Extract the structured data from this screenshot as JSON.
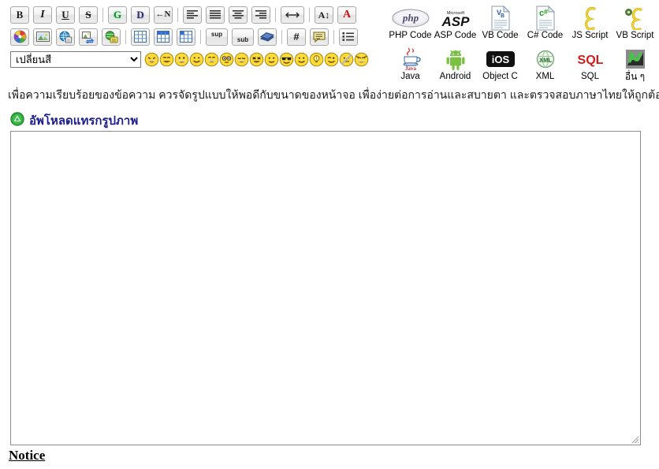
{
  "editor": {
    "toolbar_row1": [
      {
        "name": "bold-button",
        "glyph": "B",
        "cls": "bold-g",
        "title": "Bold"
      },
      {
        "name": "italic-button",
        "glyph": "I",
        "cls": "ital-g",
        "title": "Italic"
      },
      {
        "name": "underline-button",
        "glyph": "U",
        "cls": "und-g",
        "title": "Underline"
      },
      {
        "name": "strikethrough-button",
        "glyph": "S",
        "cls": "strk-g",
        "title": "Strikethrough"
      },
      {
        "name": "separator",
        "glyph": "",
        "cls": "",
        "title": ""
      },
      {
        "name": "glow-text-button",
        "glyph": "G",
        "cls": "glow-g",
        "title": "Glow"
      },
      {
        "name": "shadow-text-button",
        "glyph": "D",
        "cls": "shad-g",
        "title": "Shadow"
      },
      {
        "name": "right-to-left-button",
        "glyph": "←N",
        "cls": "rtl-g",
        "title": "Right to left"
      },
      {
        "name": "separator",
        "glyph": "",
        "cls": "",
        "title": ""
      },
      {
        "name": "align-left-button",
        "glyph": "",
        "cls": "",
        "title": "Align left"
      },
      {
        "name": "align-justify-button",
        "glyph": "",
        "cls": "",
        "title": "Justify"
      },
      {
        "name": "align-center-button",
        "glyph": "",
        "cls": "",
        "title": "Align center"
      },
      {
        "name": "align-right-button",
        "glyph": "",
        "cls": "",
        "title": "Align right"
      },
      {
        "name": "separator",
        "glyph": "",
        "cls": "",
        "title": ""
      },
      {
        "name": "horizontal-rule-button",
        "glyph": "↔",
        "cls": "",
        "title": "Horizontal rule"
      },
      {
        "name": "separator",
        "glyph": "",
        "cls": "",
        "title": ""
      },
      {
        "name": "font-size-button",
        "glyph": "A↕",
        "cls": "fsz-g",
        "title": "Font size"
      },
      {
        "name": "font-color-button",
        "glyph": "A",
        "cls": "fcol-g",
        "title": "Font color"
      }
    ],
    "toolbar_row2": [
      {
        "name": "color-wheel-button",
        "title": "Color wheel"
      },
      {
        "name": "insert-image-button",
        "title": "Insert image"
      },
      {
        "name": "insert-link-button",
        "title": "Insert link"
      },
      {
        "name": "insert-media-button",
        "title": "Insert media"
      },
      {
        "name": "insert-flash-button",
        "title": "Insert flash"
      },
      {
        "name": "separator",
        "title": ""
      },
      {
        "name": "insert-table-button",
        "title": "Insert table"
      },
      {
        "name": "table-header-button",
        "title": "Table header"
      },
      {
        "name": "table-cell-button",
        "title": "Table cell"
      },
      {
        "name": "separator",
        "title": ""
      },
      {
        "name": "superscript-button",
        "title": "Superscript"
      },
      {
        "name": "subscript-button",
        "title": "Subscript"
      },
      {
        "name": "insert-book-button",
        "title": "Insert book"
      },
      {
        "name": "separator",
        "title": ""
      },
      {
        "name": "numbered-list-button",
        "title": "Numbered list"
      },
      {
        "name": "quote-button",
        "title": "Quote"
      },
      {
        "name": "separator",
        "title": ""
      },
      {
        "name": "bullet-list-button",
        "title": "Bullet list"
      }
    ],
    "color_select": {
      "selected": "เปลี่ยนสี",
      "options": [
        "เปลี่ยนสี"
      ]
    },
    "emoticons": [
      {
        "name": "emoticon-laugh",
        "label": "laugh"
      },
      {
        "name": "emoticon-grin",
        "label": "grin"
      },
      {
        "name": "emoticon-bigsmile",
        "label": "big-smile"
      },
      {
        "name": "emoticon-smile",
        "label": "smile"
      },
      {
        "name": "emoticon-happy",
        "label": "happy"
      },
      {
        "name": "emoticon-surprised",
        "label": "surprised"
      },
      {
        "name": "emoticon-sleepy",
        "label": "sleepy"
      },
      {
        "name": "emoticon-cool",
        "label": "cool"
      },
      {
        "name": "emoticon-neutral",
        "label": "neutral"
      },
      {
        "name": "emoticon-sunglasses",
        "label": "sunglasses"
      },
      {
        "name": "emoticon-plain",
        "label": "plain"
      },
      {
        "name": "emoticon-idea",
        "label": "idea"
      },
      {
        "name": "emoticon-wink",
        "label": "wink"
      },
      {
        "name": "emoticon-nocomment",
        "label": "no-comment"
      },
      {
        "name": "emoticon-devil",
        "label": "devil"
      }
    ],
    "hint_text": "เพื่อความเรียบร้อยของข้อความ ควรจัดรูปแบบให้พอดีกับขนาดของหน้าจอ เพื่อง่ายต่อการอ่านและสบายตา และตรวจสอบภาษาไทยให้ถูกต้อง",
    "upload_link": "อัพโหลดแทรกรูปภาพ",
    "textarea_value": "",
    "textarea_placeholder": ""
  },
  "code_panel": {
    "row1": [
      {
        "name": "php-code-button",
        "label": "PHP Code",
        "icon": "php-icon"
      },
      {
        "name": "asp-code-button",
        "label": "ASP Code",
        "icon": "asp-icon"
      },
      {
        "name": "vb-code-button",
        "label": "VB Code",
        "icon": "vb-document-icon"
      },
      {
        "name": "csharp-code-button",
        "label": "C# Code",
        "icon": "csharp-document-icon"
      },
      {
        "name": "js-script-button",
        "label": "JS Script",
        "icon": "js-scroll-icon"
      },
      {
        "name": "vb-script-button",
        "label": "VB Script",
        "icon": "vb-scroll-icon"
      }
    ],
    "row2": [
      {
        "name": "java-code-button",
        "label": "Java",
        "icon": "java-cup-icon"
      },
      {
        "name": "android-code-button",
        "label": "Android",
        "icon": "android-robot-icon"
      },
      {
        "name": "objectc-code-button",
        "label": "Object C",
        "icon": "ios-icon"
      },
      {
        "name": "xml-code-button",
        "label": "XML",
        "icon": "xml-globe-icon"
      },
      {
        "name": "sql-code-button",
        "label": "SQL",
        "icon": "sql-text-icon"
      },
      {
        "name": "other-code-button",
        "label": "อื่น ๆ",
        "icon": "other-icon"
      }
    ]
  },
  "footer": {
    "notice_label": "Notice"
  },
  "colors": {
    "link": "#1c1c8c",
    "button_border": "#a9a9a9",
    "upload_icon_green": "#2faa3c",
    "emoticon_yellow": "#ffd000",
    "sql_red": "#d21b1b"
  }
}
